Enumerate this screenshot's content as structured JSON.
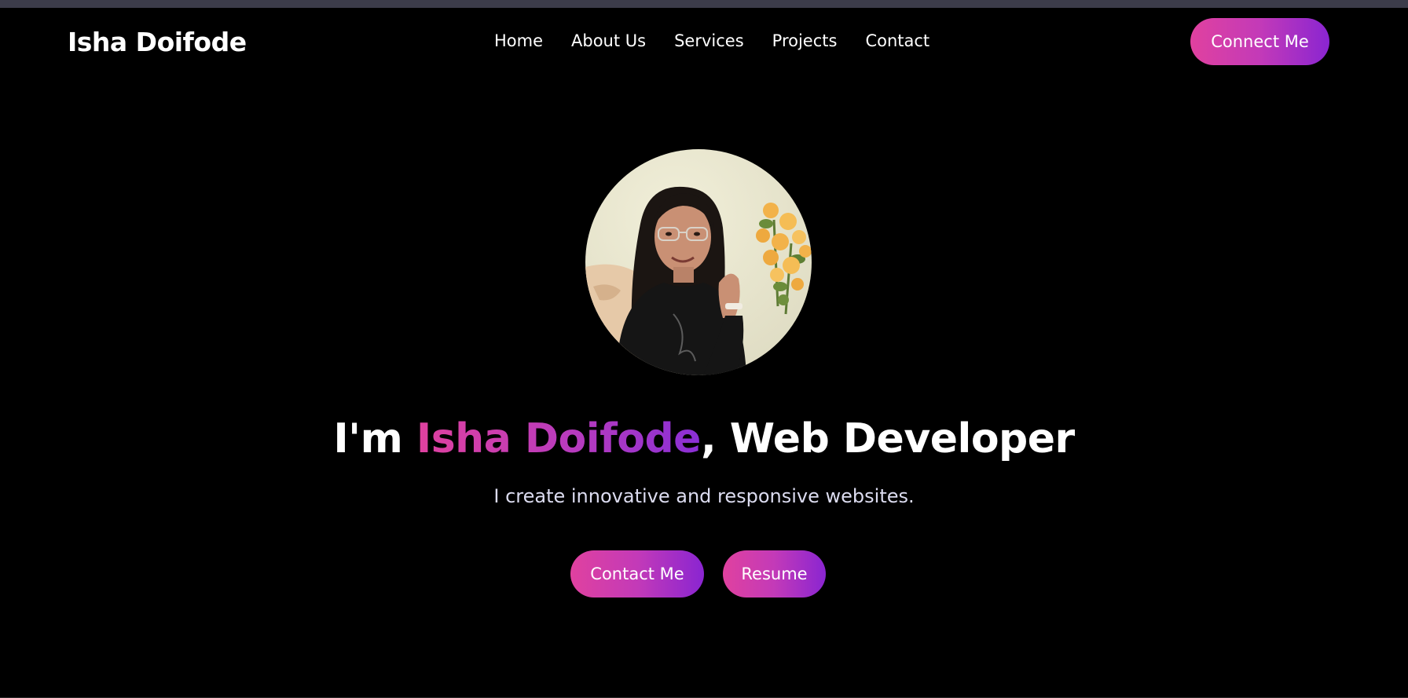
{
  "navbar": {
    "logo": "Isha Doifode",
    "links": [
      "Home",
      "About Us",
      "Services",
      "Projects",
      "Contact"
    ],
    "connect_label": "Connect Me"
  },
  "hero": {
    "prefix": "I'm ",
    "name": "Isha Doifode",
    "suffix": ", Web Developer",
    "subtitle": "I create innovative and responsive websites.",
    "contact_label": "Contact Me",
    "resume_label": "Resume"
  },
  "colors": {
    "background": "#000000",
    "gradient_start": "#e0419f",
    "gradient_end": "#8a25d1"
  }
}
